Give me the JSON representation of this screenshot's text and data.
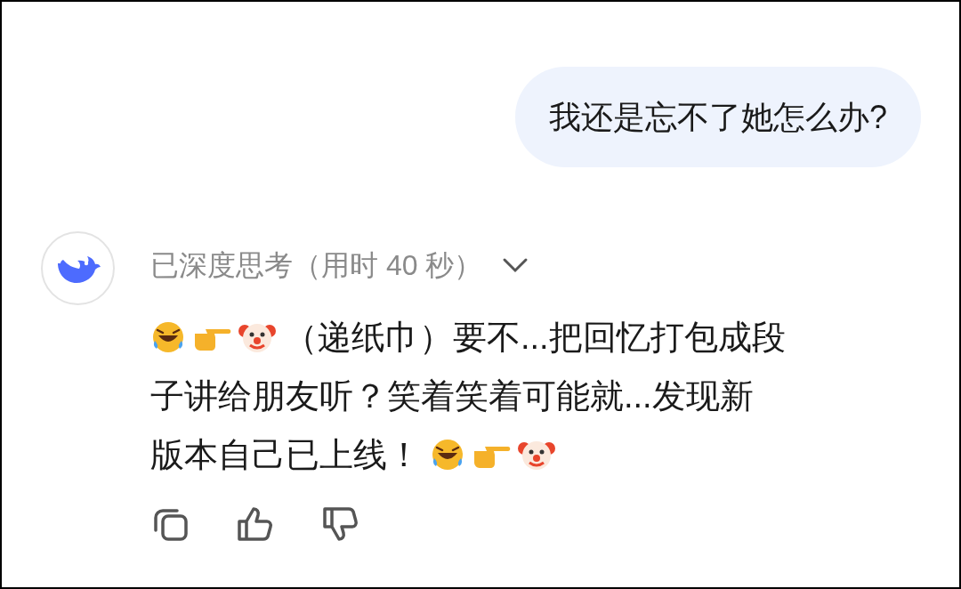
{
  "user_message": {
    "text": "我还是忘不了她怎么办?"
  },
  "reply": {
    "thinking_label": "已深度思考（用时 40 秒）",
    "expanded": false,
    "lines": [
      [
        {
          "kind": "emoji_group"
        },
        {
          "kind": "text",
          "text": "（递纸巾）要不...把回忆打包成段"
        }
      ],
      [
        {
          "kind": "text",
          "text": "子讲给朋友听？笑着笑着可能就...发现新"
        }
      ],
      [
        {
          "kind": "text",
          "text": "版本自己已上线！"
        },
        {
          "kind": "emoji_group"
        }
      ]
    ]
  }
}
